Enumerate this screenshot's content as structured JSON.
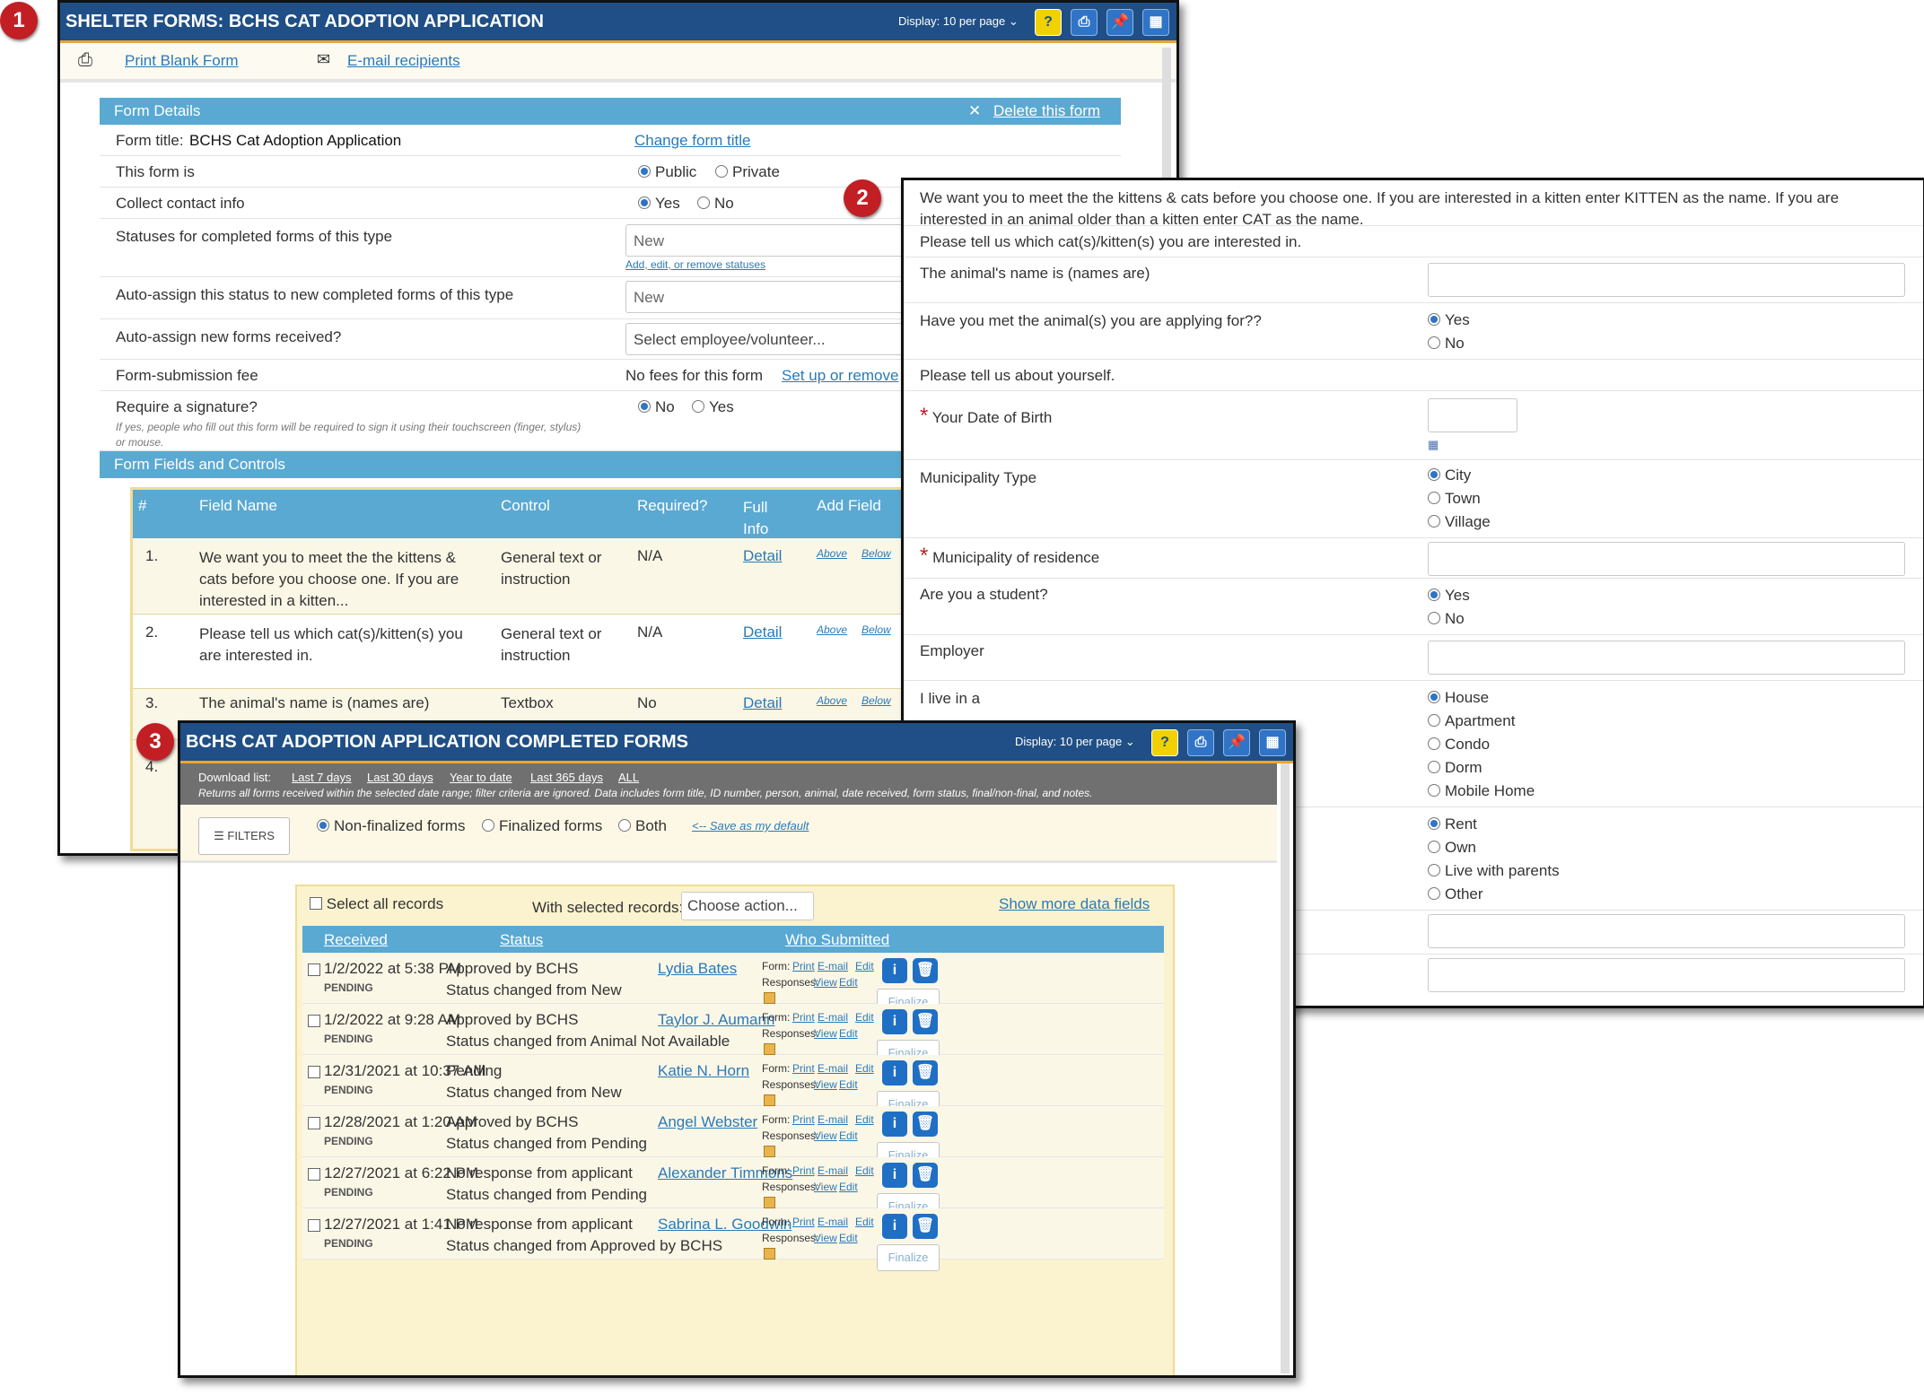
{
  "badges": [
    "1",
    "2",
    "3"
  ],
  "colors": {
    "titlebar": "#1f4f86",
    "accent": "#e7a634",
    "section": "#5aa9d2",
    "link": "#2a7ab8",
    "badge": "#c11f24"
  },
  "win1": {
    "title": "SHELTER FORMS: BCHS CAT ADOPTION APPLICATION",
    "display": "Display: 10 per page",
    "toolbar": {
      "print_blank": "Print Blank Form",
      "email_recipients": "E-mail recipients"
    },
    "form_details": {
      "header": "Form Details",
      "delete": "Delete this form",
      "title_label": "Form title:",
      "title_value": "BCHS Cat Adoption Application",
      "change_title": "Change form title",
      "form_is_label": "This form is",
      "form_is_options": [
        "Public",
        "Private"
      ],
      "contact_label": "Collect contact info",
      "contact_options": [
        "Yes",
        "No"
      ],
      "statuses_label": "Statuses for completed forms of this type",
      "statuses_value": "New",
      "statuses_link": "Add, edit, or remove statuses",
      "autoassign_status_label": "Auto-assign this status to new completed forms of this type",
      "autoassign_status_value": "New",
      "autoassign_forms_label": "Auto-assign new forms received?",
      "autoassign_forms_value": "Select employee/volunteer...",
      "fee_label": "Form-submission fee",
      "fee_value": "No fees for this form",
      "fee_link": "Set up or remove",
      "signature_label": "Require a signature?",
      "signature_note": "If yes, people who fill out this form will be required to sign it using their touchscreen (finger, stylus) or mouse.",
      "signature_options": [
        "No",
        "Yes"
      ]
    },
    "fields_section": {
      "header": "Form Fields and Controls",
      "columns": [
        "#",
        "Field Name",
        "Control",
        "Required?",
        "Full Info",
        "Add Field"
      ],
      "rows": [
        {
          "num": "1.",
          "name": "We want you to meet the the kittens & cats before you choose one. If you are interested in a kitten...",
          "control": "General text or instruction",
          "required": "N/A",
          "info": "Detail",
          "above": "Above",
          "below": "Below"
        },
        {
          "num": "2.",
          "name": "Please tell us which cat(s)/kitten(s) you are interested in.",
          "control": "General text or instruction",
          "required": "N/A",
          "info": "Detail",
          "above": "Above",
          "below": "Below"
        },
        {
          "num": "3.",
          "name": "The animal's name is (names are)",
          "control": "Textbox",
          "required": "No",
          "info": "Detail",
          "above": "Above",
          "below": "Below"
        },
        {
          "num": "4.",
          "name": "",
          "control": "",
          "required": "",
          "info": "",
          "above": "",
          "below": ""
        }
      ]
    }
  },
  "win2": {
    "intro": "We want you to meet the the kittens & cats before you choose one. If you are interested in a kitten enter KITTEN as the name. If you are interested in an animal older than a kitten enter CAT as the name.",
    "which": "Please tell us which cat(s)/kitten(s) you are interested in.",
    "animal_name": "The animal's name is (names are)",
    "met_q": "Have you met the animal(s) you are applying for??",
    "met_options": [
      "Yes",
      "No"
    ],
    "about": "Please tell us about yourself.",
    "dob": "Your Date of Birth",
    "muni_type": "Municipality Type",
    "muni_type_options": [
      "City",
      "Town",
      "Village"
    ],
    "muni_res": "Municipality of residence",
    "student_q": "Are you a student?",
    "student_options": [
      "Yes",
      "No"
    ],
    "employer": "Employer",
    "live_q": "I live in a",
    "live_options": [
      "House",
      "Apartment",
      "Condo",
      "Dorm",
      "Mobile Home"
    ],
    "own_options": [
      "Rent",
      "Own",
      "Live with parents",
      "Other"
    ],
    "required_mark": "*"
  },
  "win3": {
    "title": "BCHS CAT ADOPTION APPLICATION COMPLETED FORMS",
    "display": "Display: 10 per page",
    "download_label": "Download list:",
    "download_links": [
      "Last 7 days",
      "Last 30 days",
      "Year to date",
      "Last 365 days",
      "ALL"
    ],
    "download_note": "Returns all forms received within the selected date range; filter criteria are ignored. Data includes form title, ID number, person, animal, date received, form status, final/non-final, and notes.",
    "filters": "FILTERS",
    "view_options": [
      "Non-finalized forms",
      "Finalized forms",
      "Both"
    ],
    "save_default": "<-- Save as my default",
    "select_all": "Select all records",
    "with_selected": "With selected records:",
    "action_placeholder": "Choose action...",
    "more_fields": "Show more data fields",
    "columns": [
      "Received",
      "Status",
      "Who Submitted"
    ],
    "labels": {
      "form": "Form:",
      "print": "Print",
      "email": "E-mail",
      "edit": "Edit",
      "responses": "Responses:",
      "view": "View",
      "finalize": "Finalize"
    },
    "records": [
      {
        "received": "1/2/2022 at 5:38 PM",
        "state": "PENDING",
        "status": "Approved by BCHS",
        "change": "Status changed from New",
        "who": "Lydia Bates"
      },
      {
        "received": "1/2/2022 at 9:28 AM",
        "state": "PENDING",
        "status": "Approved by BCHS",
        "change": "Status changed from Animal Not Available",
        "who": "Taylor J. Aumann"
      },
      {
        "received": "12/31/2021 at 10:37 AM",
        "state": "PENDING",
        "status": "Pending",
        "change": "Status changed from New",
        "who": "Katie N. Horn"
      },
      {
        "received": "12/28/2021 at 1:20 AM",
        "state": "PENDING",
        "status": "Approved by BCHS",
        "change": "Status changed from Pending",
        "who": "Angel Webster"
      },
      {
        "received": "12/27/2021 at 6:22 PM",
        "state": "PENDING",
        "status": "No response from applicant",
        "change": "Status changed from Pending",
        "who": "Alexander Timmons"
      },
      {
        "received": "12/27/2021 at 1:41 PM",
        "state": "PENDING",
        "status": "No response from applicant",
        "change": "Status changed from Approved by BCHS",
        "who": "Sabrina L. Goodwin"
      }
    ]
  }
}
